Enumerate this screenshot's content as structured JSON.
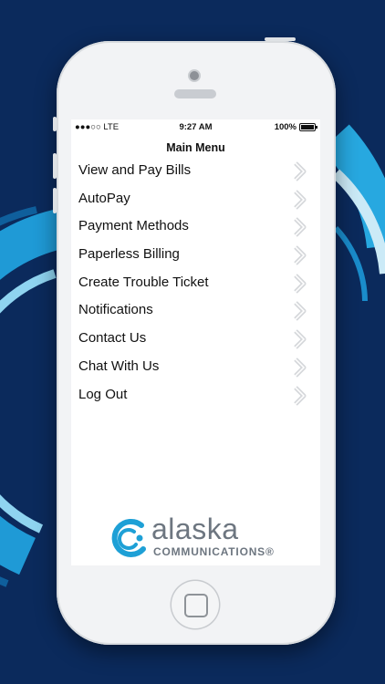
{
  "status_bar": {
    "carrier": "●●●○○ LTE",
    "time": "9:27 AM",
    "battery": "100%",
    "battery_level": 1.0
  },
  "screen": {
    "title": "Main Menu"
  },
  "menu": {
    "items": [
      {
        "label": "View and Pay Bills",
        "icon": "chevron-right-icon"
      },
      {
        "label": "AutoPay",
        "icon": "chevron-right-icon"
      },
      {
        "label": "Payment Methods",
        "icon": "chevron-right-icon"
      },
      {
        "label": "Paperless Billing",
        "icon": "chevron-right-icon"
      },
      {
        "label": "Create Trouble Ticket",
        "icon": "chevron-right-icon"
      },
      {
        "label": "Notifications",
        "icon": "chevron-right-icon"
      },
      {
        "label": "Contact Us",
        "icon": "chevron-right-icon"
      },
      {
        "label": "Chat With Us",
        "icon": "chevron-right-icon"
      },
      {
        "label": "Log Out",
        "icon": "chevron-right-icon"
      }
    ]
  },
  "logo": {
    "wordmark": "alaska",
    "subtitle": "COMMUNICATIONS®",
    "icon": "alaska-swirl-logo"
  },
  "colors": {
    "background": "#0b2a5c",
    "accent_light": "#26a9e0",
    "accent_pale": "#8fd4f0",
    "logo_gray": "#6d7680",
    "logo_teal": "#1ea0d6"
  }
}
